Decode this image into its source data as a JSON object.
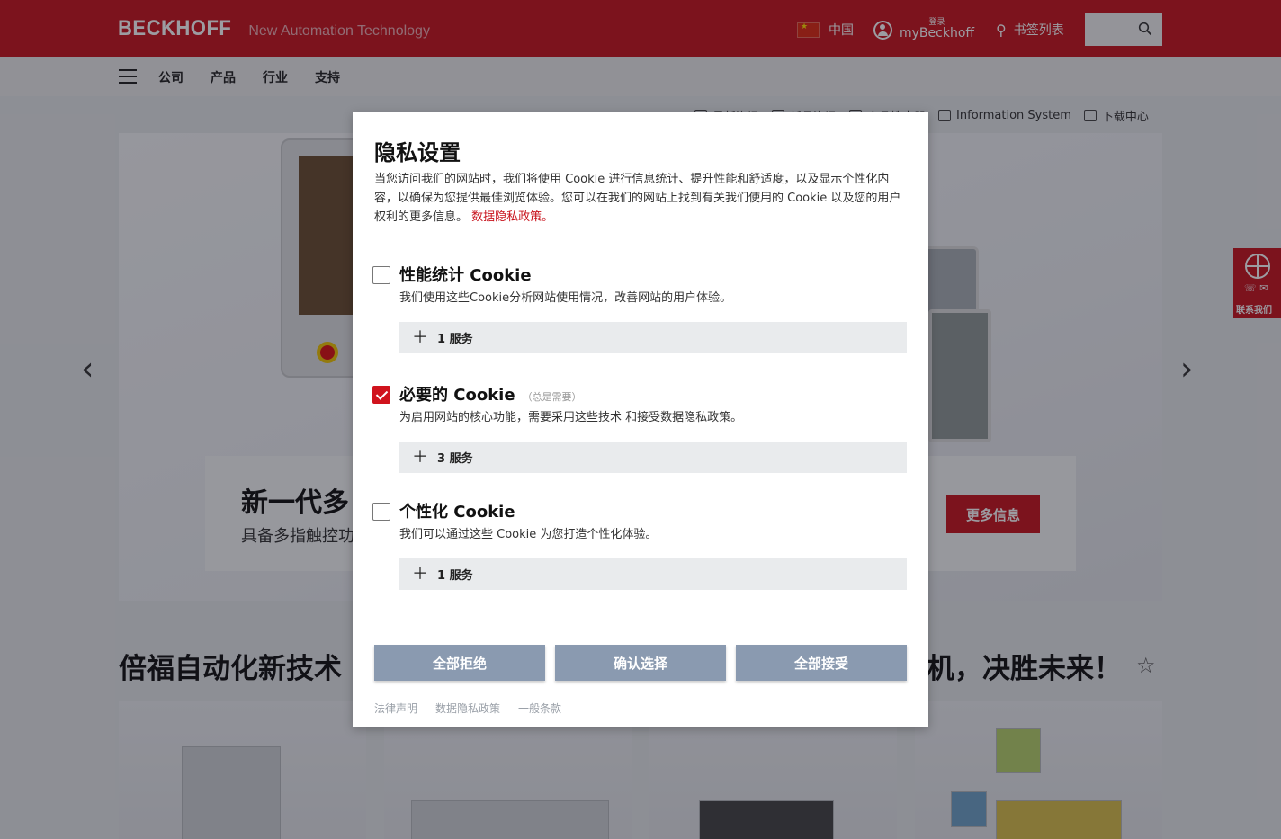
{
  "header": {
    "brand": "BECKHOFF",
    "slogan": "New Automation Technology",
    "country": "中国",
    "login_small": "登录",
    "login_big": "myBeckhoff",
    "bookmarks": "书签列表",
    "search_placeholder": ""
  },
  "nav": {
    "items": [
      "公司",
      "产品",
      "行业",
      "支持"
    ]
  },
  "utility_links": [
    "最新资讯",
    "新品资讯",
    "产品搜索器",
    "Information System",
    "下载中心"
  ],
  "hero": {
    "title": "新一代多",
    "subtitle": "具备多指触控功",
    "button": "更多信息"
  },
  "contact": {
    "label": "联系我们"
  },
  "section": {
    "slogan_left": "倍福自动化新技术",
    "slogan_right": "机，决胜未来！"
  },
  "modal": {
    "title": "隐私设置",
    "description": "当您访问我们的网站时，我们将使用 Cookie 进行信息统计、提升性能和舒适度，以及显示个性化内容，以确保为您提供最佳浏览体验。您可以在我们的网站上找到有关我们使用的 Cookie 以及您的用户权利的更多信息。",
    "privacy_link": "数据隐私政策。",
    "sections": [
      {
        "title": "性能统计 Cookie",
        "note": "",
        "checked": false,
        "description": "我们使用这些Cookie分析网站使用情况，改善网站的用户体验。",
        "services": "1 服务"
      },
      {
        "title": "必要的 Cookie",
        "note": "（总是需要）",
        "checked": true,
        "description": "为启用网站的核心功能，需要采用这些技术 和接受数据隐私政策。",
        "services": "3 服务"
      },
      {
        "title": "个性化 Cookie",
        "note": "",
        "checked": false,
        "description": "我们可以通过这些 Cookie 为您打造个性化体验。",
        "services": "1 服务"
      }
    ],
    "buttons": {
      "reject_all": "全部拒绝",
      "confirm": "确认选择",
      "accept_all": "全部接受"
    },
    "footer_links": [
      "法律声明",
      "数据隐私政策",
      "一般条款"
    ]
  },
  "colors": {
    "brand_red": "#c8131d",
    "button_gray_blue": "#8a9ab0"
  }
}
